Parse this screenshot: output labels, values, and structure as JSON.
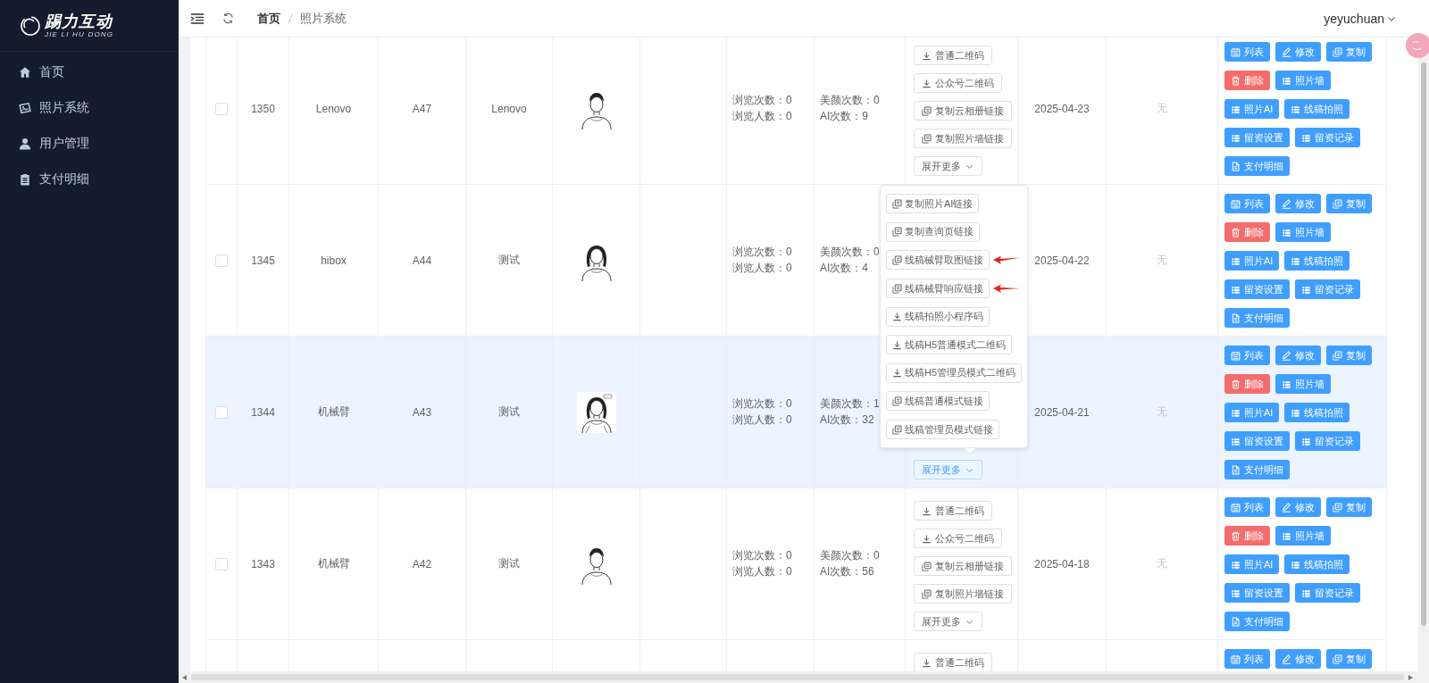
{
  "sidebar": {
    "logo": {
      "name": "踢力互动",
      "subtitle": "JIE LI HU DONG"
    },
    "items": [
      {
        "label": "首页",
        "selected": false
      },
      {
        "label": "照片系统",
        "selected": false
      },
      {
        "label": "用户管理",
        "selected": false
      },
      {
        "label": "支付明细",
        "selected": false
      }
    ]
  },
  "header": {
    "breadcrumb": [
      "首页",
      "照片系统"
    ],
    "user": "yeyuchuan"
  },
  "table": {
    "rows": [
      {
        "checked": false,
        "highlighted": false,
        "id": "1350",
        "name": "Lenovo",
        "code": "A47",
        "group": "Lenovo",
        "photo": {
          "kind": "picture"
        },
        "views": [
          "浏览次数：0",
          "浏览人数：0"
        ],
        "usage": [
          "美颜次数：0",
          "AI次数：9"
        ],
        "links": [
          {
            "label": "普通二维码",
            "kind": "download"
          },
          {
            "label": "公众号二维码",
            "kind": "download"
          },
          {
            "label": "复制云相册链接",
            "kind": "copy"
          },
          {
            "label": "复制照片墙链接",
            "kind": "copy"
          }
        ],
        "expand": {
          "label": "展开更多",
          "active": false
        },
        "date": "2025-04-23",
        "extra": "无",
        "actions": [
          {
            "label": "列表",
            "kind": "primary"
          },
          {
            "label": "修改",
            "kind": "primary"
          },
          {
            "label": "复制",
            "kind": "primary"
          },
          {
            "label": "删除",
            "kind": "danger"
          },
          {
            "label": "照片墙",
            "kind": "primary"
          },
          {
            "label": "照片AI",
            "kind": "primary"
          },
          {
            "label": "线稿拍照",
            "kind": "primary"
          },
          {
            "label": "留资设置",
            "kind": "primary"
          },
          {
            "label": "留资记录",
            "kind": "primary"
          },
          {
            "label": "支付明细",
            "kind": "primary"
          }
        ]
      },
      {
        "checked": false,
        "highlighted": false,
        "id": "1345",
        "name": "hibox",
        "code": "A44",
        "group": "测试",
        "photo": {
          "kind": "picture"
        },
        "views": [
          "浏览次数：0",
          "浏览人数：0"
        ],
        "usage": [
          "美颜次数：0",
          "AI次数：4"
        ],
        "date": "2025-04-22",
        "extra": "无",
        "actions": [
          {
            "label": "列表",
            "kind": "primary"
          },
          {
            "label": "修改",
            "kind": "primary"
          },
          {
            "label": "复制",
            "kind": "primary"
          },
          {
            "label": "删除",
            "kind": "danger"
          },
          {
            "label": "照片墙",
            "kind": "primary"
          },
          {
            "label": "照片AI",
            "kind": "primary"
          },
          {
            "label": "线稿拍照",
            "kind": "primary"
          },
          {
            "label": "留资设置",
            "kind": "primary"
          },
          {
            "label": "留资记录",
            "kind": "primary"
          },
          {
            "label": "支付明细",
            "kind": "primary"
          }
        ]
      },
      {
        "checked": false,
        "highlighted": true,
        "id": "1344",
        "name": "机械臂",
        "code": "A43",
        "group": "测试",
        "photo": {
          "kind": "picture"
        },
        "views": [
          "浏览次数：0",
          "浏览人数：0"
        ],
        "usage": [
          "美颜次数：1",
          "AI次数：32"
        ],
        "expand": {
          "label": "展开更多",
          "active": true
        },
        "date": "2025-04-21",
        "extra": "无",
        "menu": {
          "items": [
            {
              "label": "复制照片AI链接",
              "kind": "copy",
              "marked": false
            },
            {
              "label": "复制查询页链接",
              "kind": "copy",
              "marked": false
            },
            {
              "label": "线稿械臂取图链接",
              "kind": "copy",
              "marked": true
            },
            {
              "label": "线稿械臂响应链接",
              "kind": "copy",
              "marked": true
            },
            {
              "label": "线稿拍照小程序码",
              "kind": "download",
              "marked": false
            },
            {
              "label": "线稿H5普通模式二维码",
              "kind": "download",
              "marked": false
            },
            {
              "label": "线稿H5管理员模式二维码",
              "kind": "download",
              "marked": false
            },
            {
              "label": "线稿普通模式链接",
              "kind": "copy",
              "marked": false
            },
            {
              "label": "线稿管理员模式链接",
              "kind": "copy",
              "marked": false
            }
          ]
        },
        "actions": [
          {
            "label": "列表",
            "kind": "primary"
          },
          {
            "label": "修改",
            "kind": "primary"
          },
          {
            "label": "复制",
            "kind": "primary"
          },
          {
            "label": "删除",
            "kind": "danger"
          },
          {
            "label": "照片墙",
            "kind": "primary"
          },
          {
            "label": "照片AI",
            "kind": "primary"
          },
          {
            "label": "线稿拍照",
            "kind": "primary"
          },
          {
            "label": "留资设置",
            "kind": "primary"
          },
          {
            "label": "留资记录",
            "kind": "primary"
          },
          {
            "label": "支付明细",
            "kind": "primary"
          }
        ]
      },
      {
        "checked": false,
        "highlighted": false,
        "id": "1343",
        "name": "机械臂",
        "code": "A42",
        "group": "测试",
        "photo": {
          "kind": "picture"
        },
        "views": [
          "浏览次数：0",
          "浏览人数：0"
        ],
        "usage": [
          "美颜次数：0",
          "AI次数：56"
        ],
        "links": [
          {
            "label": "普通二维码",
            "kind": "download"
          },
          {
            "label": "公众号二维码",
            "kind": "download"
          },
          {
            "label": "复制云相册链接",
            "kind": "copy"
          },
          {
            "label": "复制照片墙链接",
            "kind": "copy"
          }
        ],
        "expand": {
          "label": "展开更多",
          "active": false
        },
        "date": "2025-04-18",
        "extra": "无",
        "actions": [
          {
            "label": "列表",
            "kind": "primary"
          },
          {
            "label": "修改",
            "kind": "primary"
          },
          {
            "label": "复制",
            "kind": "primary"
          },
          {
            "label": "删除",
            "kind": "danger"
          },
          {
            "label": "照片墙",
            "kind": "primary"
          },
          {
            "label": "照片AI",
            "kind": "primary"
          },
          {
            "label": "线稿拍照",
            "kind": "primary"
          },
          {
            "label": "留资设置",
            "kind": "primary"
          },
          {
            "label": "留资记录",
            "kind": "primary"
          },
          {
            "label": "支付明细",
            "kind": "primary"
          }
        ]
      },
      {
        "links": [
          {
            "label": "普通二维码",
            "kind": "download"
          }
        ],
        "actions": [
          {
            "label": "列表",
            "kind": "primary"
          },
          {
            "label": "修改",
            "kind": "primary"
          },
          {
            "label": "复制",
            "kind": "primary"
          }
        ]
      }
    ]
  }
}
